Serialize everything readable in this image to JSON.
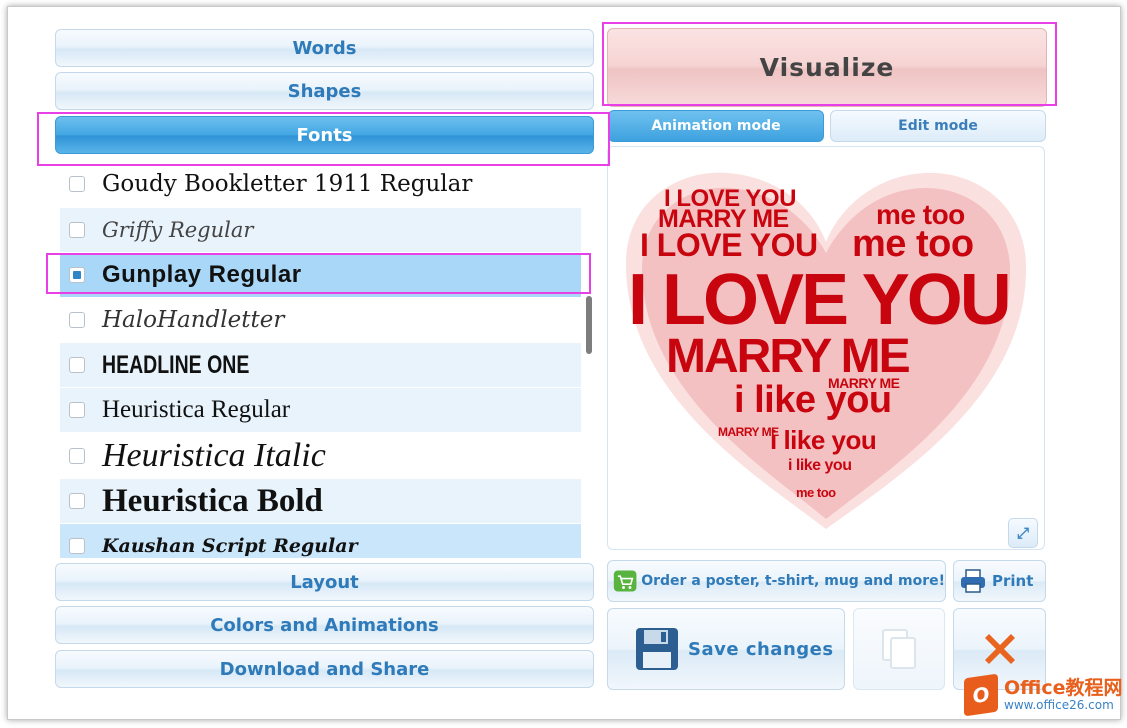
{
  "accordion": {
    "words": "Words",
    "shapes": "Shapes",
    "fonts": "Fonts",
    "layout": "Layout",
    "colors": "Colors and Animations",
    "download": "Download and Share"
  },
  "fonts": [
    {
      "label": "Goudy Bookletter 1911 Regular",
      "checked": false
    },
    {
      "label": "Griffy Regular",
      "checked": false
    },
    {
      "label": "Gunplay Regular",
      "checked": true
    },
    {
      "label": "HaloHandletter",
      "checked": false
    },
    {
      "label": "HEADLINE ONE",
      "checked": false
    },
    {
      "label": "Heuristica Regular",
      "checked": false
    },
    {
      "label": "Heuristica Italic",
      "checked": false
    },
    {
      "label": "Heuristica Bold",
      "checked": false
    },
    {
      "label": "Kaushan Script Regular",
      "checked": false
    }
  ],
  "right": {
    "visualize": "Visualize",
    "animation_mode": "Animation mode",
    "edit_mode": "Edit mode",
    "order": "Order a poster, t-shirt, mug and more!",
    "print": "Print",
    "save": "Save changes"
  },
  "wordcloud": {
    "color": "#c8050f",
    "phrases": [
      "I LOVE YOU",
      "MARRY ME",
      "me too",
      "i like you"
    ]
  },
  "logo": {
    "name": "Office教程网",
    "url": "www.office26.com"
  }
}
